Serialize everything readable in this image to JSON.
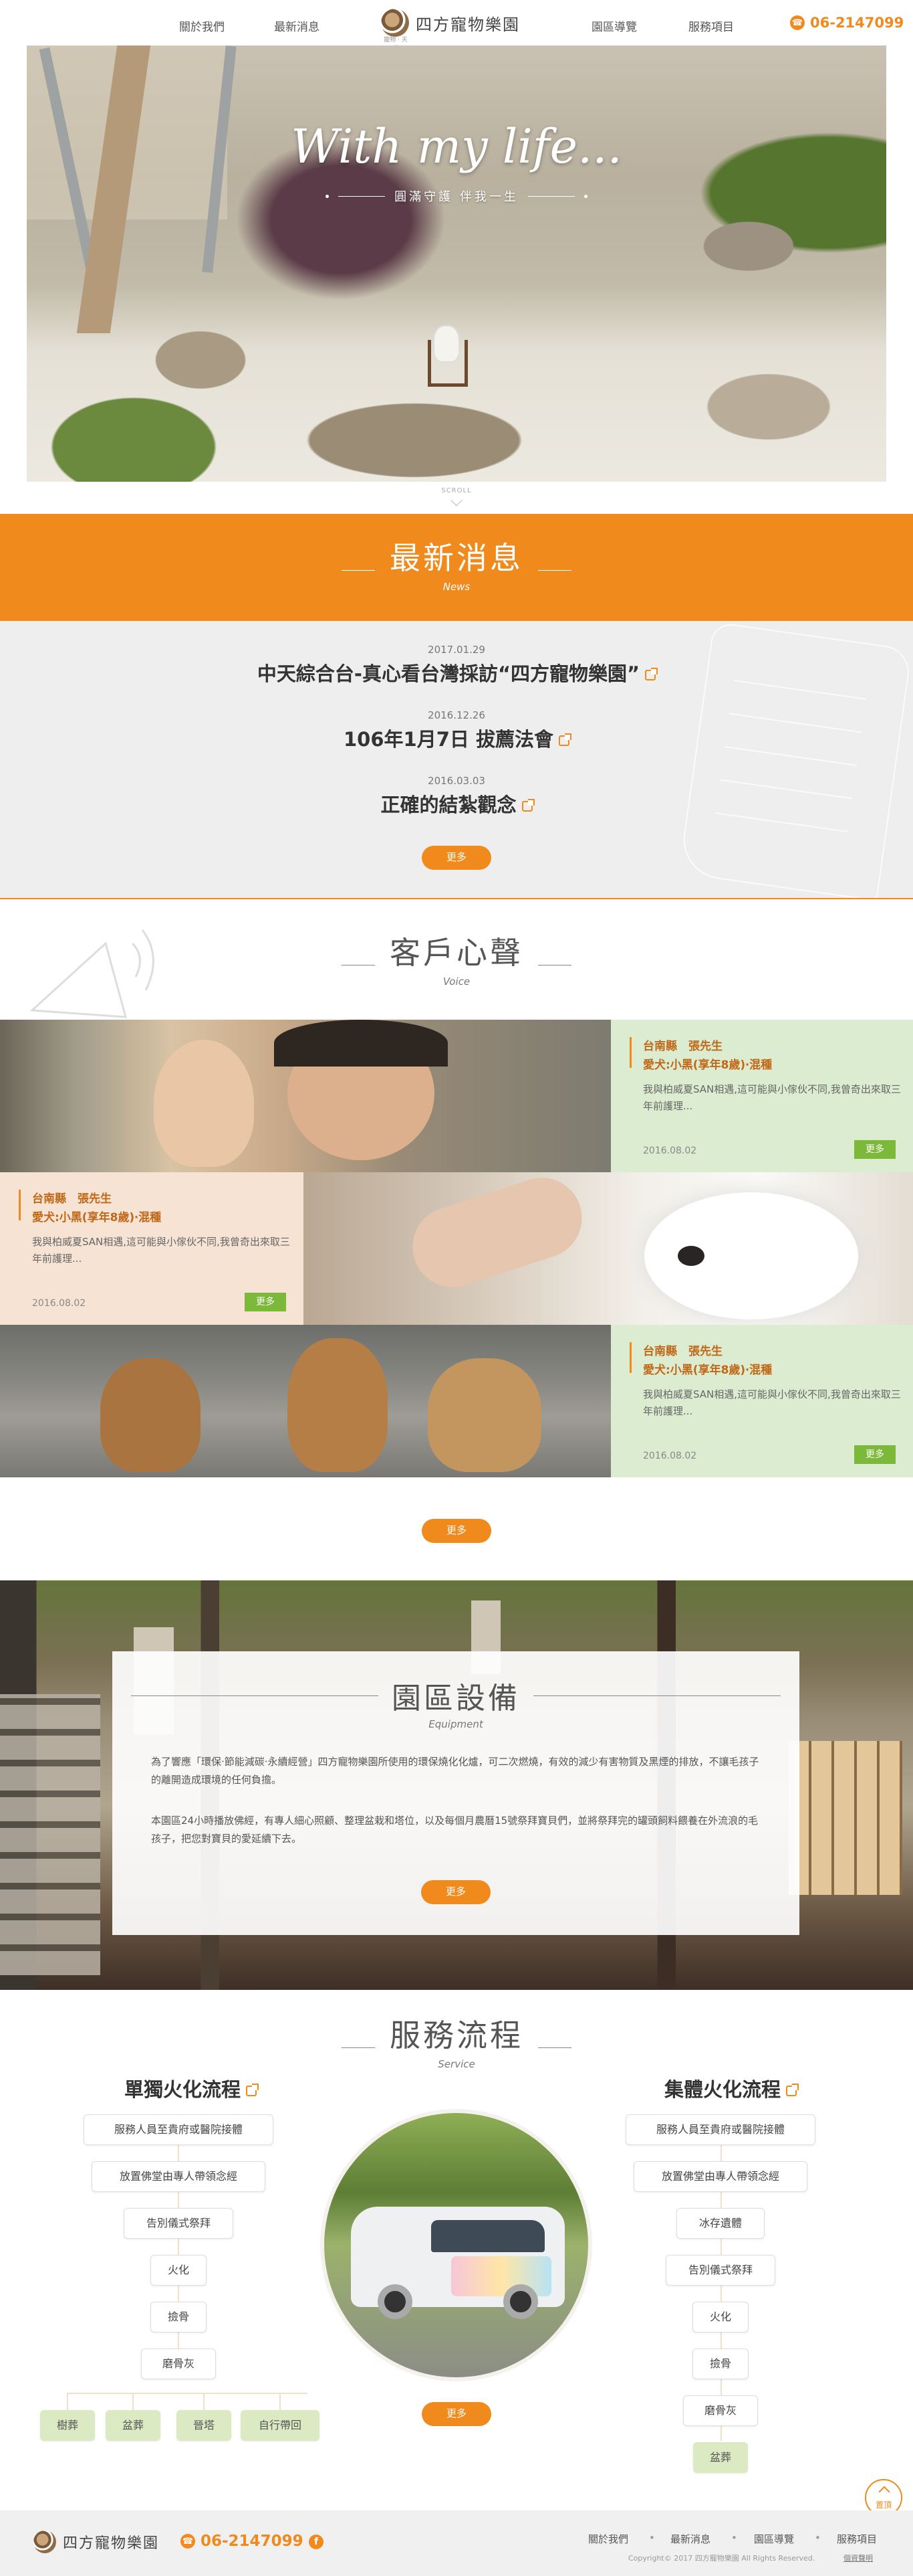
{
  "header": {
    "nav_left": [
      "關於我們",
      "最新消息"
    ],
    "nav_right": [
      "園區導覽",
      "服務項目"
    ],
    "logo_name": "四方寵物樂園",
    "logo_sub": "寵物 · 天堂",
    "phone": "06-2147099"
  },
  "hero": {
    "title": "With my life...",
    "subtitle": "圓滿守護 伴我一生",
    "scroll_label": "SCROLL"
  },
  "news": {
    "title": "最新消息",
    "subtitle": "News",
    "items": [
      {
        "date": "2017.01.29",
        "title": "中天綜合台-真心看台灣採訪“四方寵物樂園”"
      },
      {
        "date": "2016.12.26",
        "title": "106年1月7日 拔薦法會"
      },
      {
        "date": "2016.03.03",
        "title": "正確的結紮觀念"
      }
    ],
    "more": "更多"
  },
  "voice": {
    "title": "客戶心聲",
    "subtitle": "Voice",
    "items": [
      {
        "name": "台南縣　張先生",
        "pet": "愛犬:小黑(享年8歲)‧混種",
        "text": "我與柏威夏SAN相遇,這可能與小傢伙不同,我曾奇出來取三年前護理...",
        "date": "2016.08.02",
        "more": "更多"
      },
      {
        "name": "台南縣　張先生",
        "pet": "愛犬:小黑(享年8歲)‧混種",
        "text": "我與柏威夏SAN相遇,這可能與小傢伙不同,我曾奇出來取三年前護理...",
        "date": "2016.08.02",
        "more": "更多"
      },
      {
        "name": "台南縣　張先生",
        "pet": "愛犬:小黑(享年8歲)‧混種",
        "text": "我與柏威夏SAN相遇,這可能與小傢伙不同,我曾奇出來取三年前護理...",
        "date": "2016.08.02",
        "more": "更多"
      }
    ],
    "more": "更多"
  },
  "equipment": {
    "title": "園區設備",
    "subtitle": "Equipment",
    "p1": "為了響應「環保‧節能減碳‧永續經營」四方寵物樂園所使用的環保燒化化爐，可二次燃燒，有效的減少有害物質及黑煙的排放，不讓毛孩子的離開造成環境的任何負擔。",
    "p2": "本園區24小時播放佛經，有專人細心照顧、整理盆栽和塔位，以及每個月農曆15號祭拜寶貝們，並將祭拜完的罐頭飼料餵養在外流浪的毛孩子，把您對寶貝的愛延續下去。",
    "more": "更多"
  },
  "service": {
    "title": "服務流程",
    "subtitle": "Service",
    "single": {
      "title": "單獨火化流程",
      "steps": [
        "服務人員至貴府或醫院接體",
        "放置佛堂由專人帶領念經",
        "告別儀式祭拜",
        "火化",
        "撿骨",
        "磨骨灰"
      ],
      "options": [
        "樹葬",
        "盆葬",
        "晉塔",
        "自行帶回"
      ]
    },
    "group": {
      "title": "集體火化流程",
      "steps": [
        "服務人員至貴府或醫院接體",
        "放置佛堂由專人帶領念經",
        "冰存遺體",
        "告別儀式祭拜",
        "火化",
        "撿骨",
        "磨骨灰"
      ],
      "final": "盆葬"
    },
    "more": "更多"
  },
  "to_top": "置頂",
  "footer": {
    "logo_name": "四方寵物樂園",
    "phone": "06-2147099",
    "nav": [
      "關於我們",
      "最新消息",
      "園區導覽",
      "服務項目"
    ],
    "copyright": "Copyright© 2017 四方寵物樂園 All Rights Reserved.",
    "privacy": "個資聲明"
  },
  "colors": {
    "accent": "#f08a1d",
    "green": "#7cb83a",
    "voice_green": "#dcecd0",
    "voice_peach": "#f7e3d3"
  }
}
